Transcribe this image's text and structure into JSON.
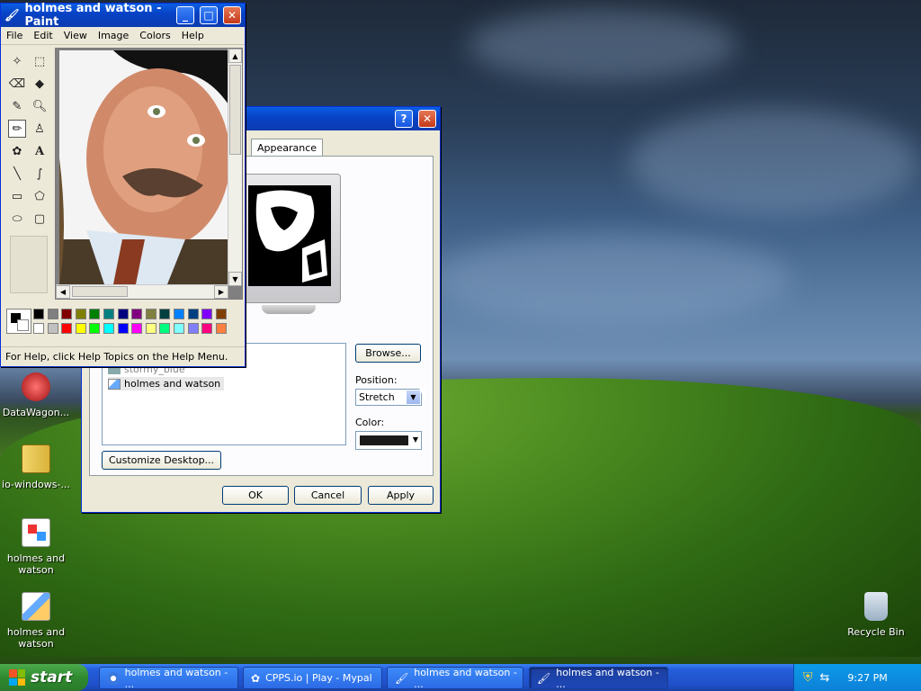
{
  "desktop": {
    "icons": [
      {
        "label": "DataWagon..."
      },
      {
        "label": "io-windows-..."
      },
      {
        "label": "holmes and watson"
      },
      {
        "label": "holmes and watson"
      },
      {
        "label": "Recycle Bin"
      }
    ]
  },
  "paint": {
    "title": "holmes and watson - Paint",
    "menu": [
      "File",
      "Edit",
      "View",
      "Image",
      "Colors",
      "Help"
    ],
    "status": "For Help, click Help Topics on the Help Menu.",
    "palette_top": [
      "#000000",
      "#808080",
      "#800000",
      "#808000",
      "#008000",
      "#008080",
      "#000080",
      "#800080",
      "#808040",
      "#004040",
      "#0080ff",
      "#004080",
      "#8000ff",
      "#804000"
    ],
    "palette_bottom": [
      "#ffffff",
      "#c0c0c0",
      "#ff0000",
      "#ffff00",
      "#00ff00",
      "#00ffff",
      "#0000ff",
      "#ff00ff",
      "#ffff80",
      "#00ff80",
      "#80ffff",
      "#8080ff",
      "#ff0080",
      "#ff8040"
    ]
  },
  "display": {
    "tab_appearance": "Appearance",
    "list_items": [
      "stormy_blue",
      "holmes and watson"
    ],
    "browse_label": "Browse...",
    "position_label": "Position:",
    "position_value": "Stretch",
    "color_label": "Color:",
    "customize_label": "Customize Desktop...",
    "ok_label": "OK",
    "cancel_label": "Cancel",
    "apply_label": "Apply",
    "help_label": "?",
    "close_label": "✕"
  },
  "taskbar": {
    "start_label": "start",
    "tasks": [
      {
        "label": "holmes and watson - ..."
      },
      {
        "label": "CPPS.io | Play - Mypal"
      },
      {
        "label": "holmes and watson - ..."
      },
      {
        "label": "holmes and watson - ..."
      }
    ],
    "clock": "9:27 PM"
  }
}
